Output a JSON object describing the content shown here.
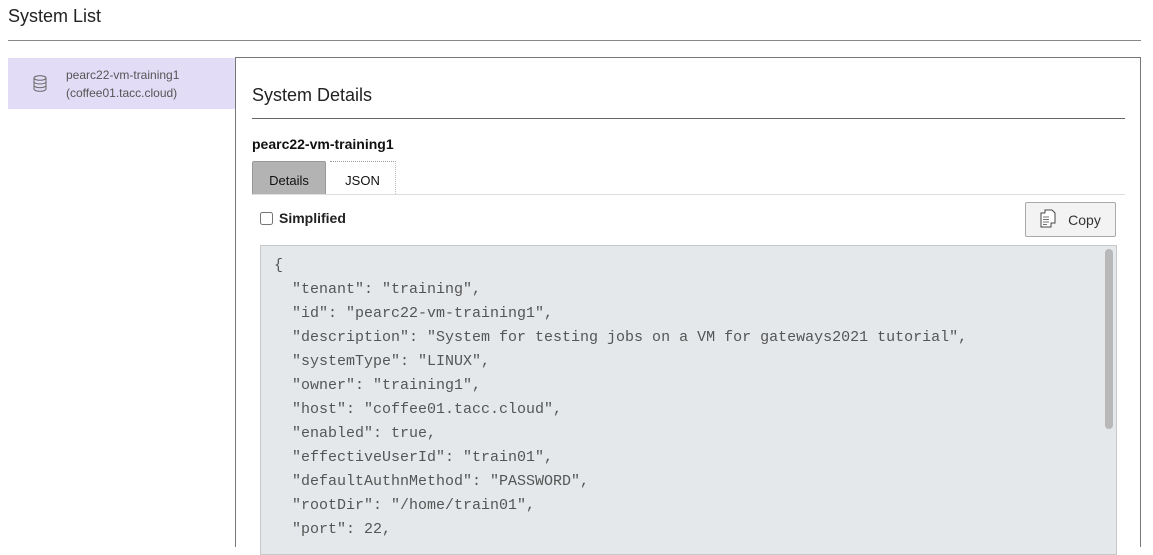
{
  "page": {
    "title": "System List"
  },
  "sidebar": {
    "items": [
      {
        "name": "pearc22-vm-training1",
        "host": "(coffee01.tacc.cloud)",
        "icon": "database-icon"
      }
    ]
  },
  "details": {
    "title": "System Details",
    "system_name": "pearc22-vm-training1",
    "tabs": [
      {
        "label": "Details",
        "active": true
      },
      {
        "label": "JSON",
        "active": false
      }
    ],
    "simplified_label": "Simplified",
    "copy_label": "Copy",
    "json_lines": [
      "{",
      "  \"tenant\": \"training\",",
      "  \"id\": \"pearc22-vm-training1\",",
      "  \"description\": \"System for testing jobs on a VM for gateways2021 tutorial\",",
      "  \"systemType\": \"LINUX\",",
      "  \"owner\": \"training1\",",
      "  \"host\": \"coffee01.tacc.cloud\",",
      "  \"enabled\": true,",
      "  \"effectiveUserId\": \"train01\",",
      "  \"defaultAuthnMethod\": \"PASSWORD\",",
      "  \"rootDir\": \"/home/train01\",",
      "  \"port\": 22,"
    ]
  },
  "colors": {
    "sidebar_selected": "#e2dcf6",
    "active_tab": "#b3b3b3",
    "code_background": "#e5e8ea"
  }
}
